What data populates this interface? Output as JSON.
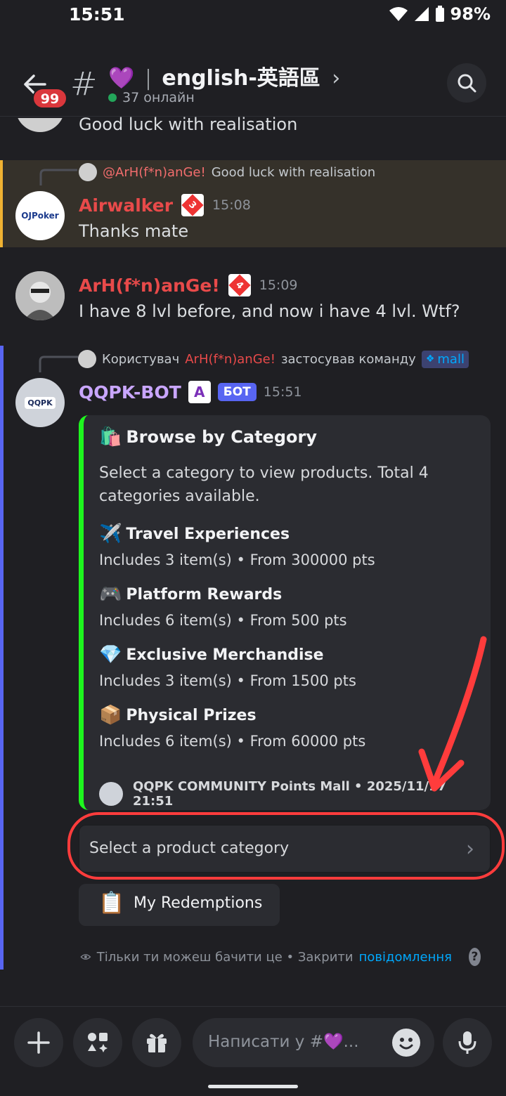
{
  "status": {
    "time": "15:51",
    "battery": "98%"
  },
  "header": {
    "unread_count": "99",
    "channel_emoji": "💜",
    "channel_name": "english-英語區",
    "online": "37 онлайн"
  },
  "messages": {
    "prev": {
      "text": "Good luck with realisation"
    },
    "reply": {
      "reply_author": "@ArH(f*n)anGe!",
      "reply_text": "Good luck with realisation",
      "author": "Airwalker",
      "avatar_text": "OJPoker",
      "badge_rank": "3",
      "time": "15:08",
      "text": "Thanks mate"
    },
    "arh": {
      "author": "ArH(f*n)anGe!",
      "badge_rank": "4",
      "time": "15:09",
      "text": "I have 8 lvl before, and now i have 4 lvl. Wtf?"
    },
    "bot": {
      "cmd_prefix": "Користувач",
      "cmd_user": "ArH(f*n)anGe!",
      "cmd_action": "застосував команду",
      "cmd_name": "mall",
      "author": "QQPK-BOT",
      "badge_rank": "A",
      "bot_tag": "БОТ",
      "time": "15:51",
      "avatar_text": "QQPK",
      "embed": {
        "title": "Browse by Category",
        "description": "Select a category to view products. Total 4 categories available.",
        "categories": [
          {
            "emoji": "✈️",
            "title": "Travel Experiences",
            "desc": "Includes 3 item(s) • From 300000 pts"
          },
          {
            "emoji": "🎮",
            "title": "Platform Rewards",
            "desc": "Includes 6 item(s) • From 500 pts"
          },
          {
            "emoji": "💎",
            "title": "Exclusive Merchandise",
            "desc": "Includes 3 item(s) • From 1500 pts"
          },
          {
            "emoji": "📦",
            "title": "Physical Prizes",
            "desc": "Includes 6 item(s) • From 60000 pts"
          }
        ],
        "footer": "QQPK COMMUNITY Points Mall • 2025/11/17 21:51",
        "accent": "#1ef61e"
      },
      "select_placeholder": "Select a product category",
      "button_emoji": "📋",
      "button_label": "My Redemptions",
      "ephemeral_text": "Тільки ти можеш бачити це • Закрити",
      "ephemeral_link": "повідомлення"
    }
  },
  "composer": {
    "placeholder": "Написати у #💜..."
  },
  "colors": {
    "highlight": "#ff3c3c",
    "blurple": "#5865f2",
    "mention_bar": "#f0b232"
  }
}
